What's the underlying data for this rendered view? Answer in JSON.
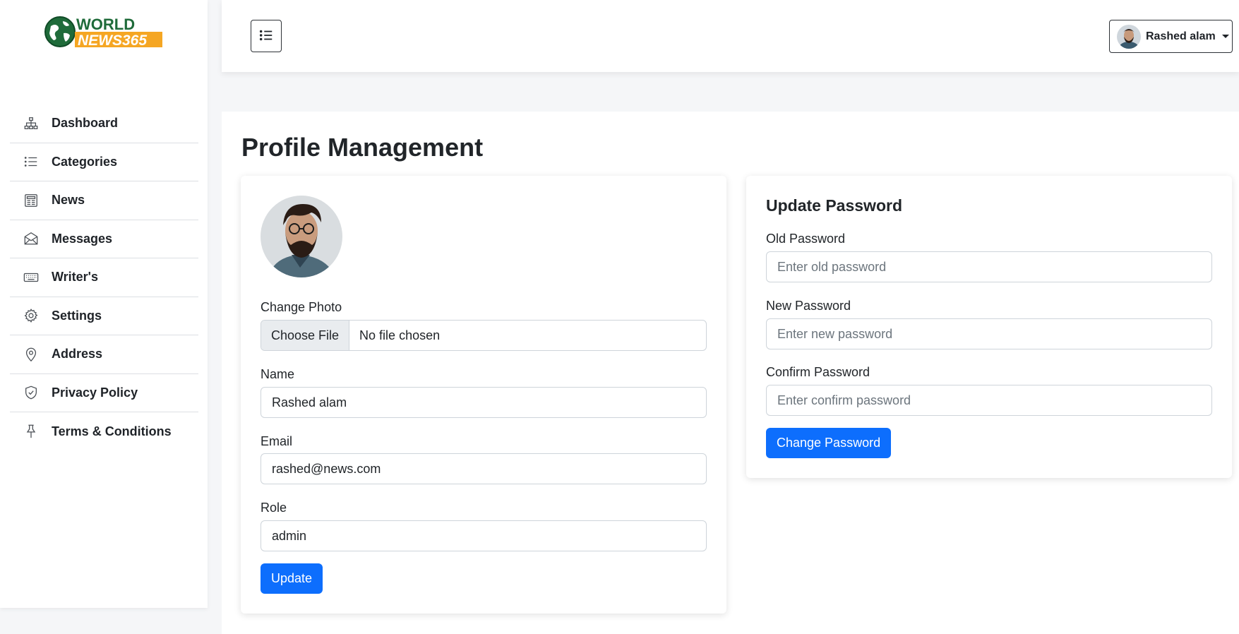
{
  "brand": {
    "line1": "WORLD",
    "line2": "NEWS365",
    "colors": {
      "green": "#1f6b3a",
      "orange": "#f5a623"
    }
  },
  "sidebar": {
    "items": [
      {
        "label": "Dashboard",
        "icon": "sitemap-icon"
      },
      {
        "label": "Categories",
        "icon": "list-icon"
      },
      {
        "label": "News",
        "icon": "newspaper-icon"
      },
      {
        "label": "Messages",
        "icon": "envelope-icon"
      },
      {
        "label": "Writer's",
        "icon": "keyboard-icon"
      },
      {
        "label": "Settings",
        "icon": "gear-icon"
      },
      {
        "label": "Address",
        "icon": "map-pin-icon"
      },
      {
        "label": "Privacy Policy",
        "icon": "shield-check-icon"
      },
      {
        "label": "Terms & Conditions",
        "icon": "pin-icon"
      }
    ]
  },
  "topbar": {
    "menu_icon": "list-icon",
    "user_name": "Rashed alam"
  },
  "page": {
    "title": "Profile Management"
  },
  "profile": {
    "change_photo_label": "Change Photo",
    "file_button": "Choose File",
    "file_status": "No file chosen",
    "name_label": "Name",
    "name_value": "Rashed alam",
    "email_label": "Email",
    "email_value": "rashed@news.com",
    "role_label": "Role",
    "role_value": "admin",
    "update_button": "Update"
  },
  "password": {
    "title": "Update Password",
    "old_label": "Old Password",
    "old_placeholder": "Enter old password",
    "new_label": "New Password",
    "new_placeholder": "Enter new password",
    "confirm_label": "Confirm Password",
    "confirm_placeholder": "Enter confirm password",
    "change_button": "Change Password"
  },
  "colors": {
    "primary": "#0d6efd",
    "text": "#212529",
    "border": "#ced4da"
  }
}
